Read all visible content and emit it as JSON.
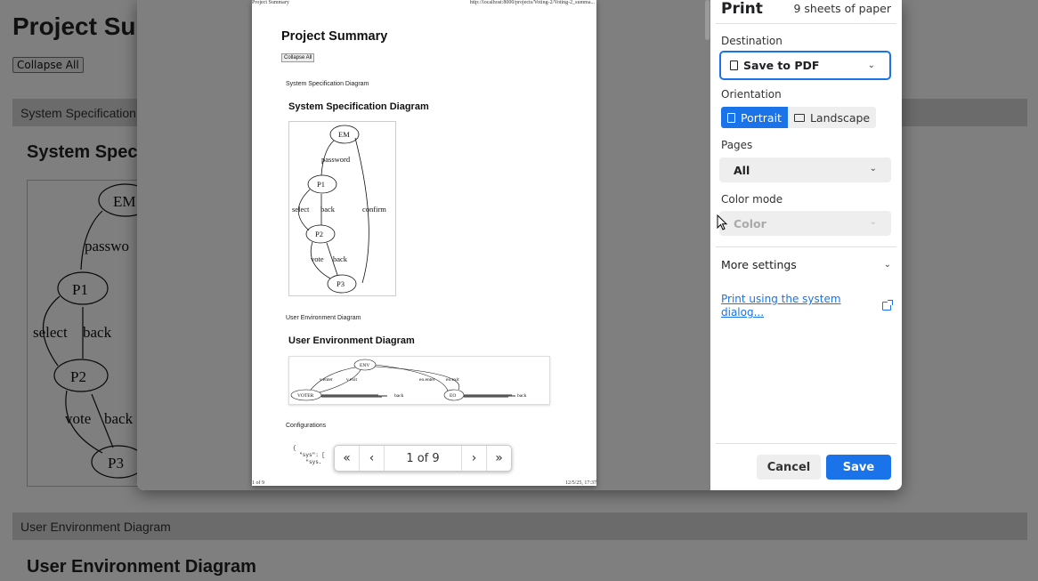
{
  "background": {
    "title": "Project Sur",
    "collapse_label": "Collapse All",
    "section1_bar": "System Specification",
    "section1_title": "System Spec",
    "diagram_labels": {
      "em": "EM",
      "password": "passwo",
      "p1": "P1",
      "select": "select",
      "back1": "back",
      "p2": "P2",
      "vote": "vote",
      "back2": "back",
      "p3": "P3"
    },
    "section2_bar": "User Environment Diagram",
    "section2_title": "User Environment Diagram"
  },
  "preview": {
    "header_left": "Project Summary",
    "header_right": "http://localhost:8000/projects/Voting-2/Voting-2_summa...",
    "title": "Project Summary",
    "collapse_label": "Collapse All",
    "section1_small": "System Specification Diagram",
    "section1_heading": "System Specification Diagram",
    "graph1": {
      "em": "EM",
      "password": "password",
      "p1": "P1",
      "select": "select",
      "back1": "back",
      "confirm": "confirm",
      "p2": "P2",
      "vote": "vote",
      "back2": "back",
      "p3": "P3"
    },
    "section2_small": "User Environment Diagram",
    "section2_heading": "User Environment Diagram",
    "graph2": {
      "env": "ENV",
      "enter": "v.enter",
      "exit": "v.exit",
      "eo_enter": "eo.enter",
      "eo_exit": "eo.exit",
      "voter": "VOTER",
      "eo": "EO",
      "back1": "back",
      "back2": "back"
    },
    "configurations": "Configurations",
    "code_line1": "{",
    "code_line2": "  \"sys\": [",
    "code_line3": "    \"sys.",
    "footer_left": "1 of 9",
    "footer_right": "12/5/25, 17:37",
    "pager": {
      "first": "«",
      "prev": "‹",
      "page": "1 of 9",
      "next": "›",
      "last": "»"
    }
  },
  "settings": {
    "title": "Print",
    "sheets": "9 sheets of paper",
    "destination_label": "Destination",
    "destination_value": "Save to PDF",
    "orientation_label": "Orientation",
    "portrait": "Portrait",
    "landscape": "Landscape",
    "pages_label": "Pages",
    "pages_value": "All",
    "color_label": "Color mode",
    "color_value": "Color",
    "more_settings": "More settings",
    "system_dialog_link": "Print using the system dialog...",
    "cancel": "Cancel",
    "save": "Save"
  },
  "colors": {
    "accent": "#1a73e8",
    "overlay": "rgba(0,0,0,0.5)",
    "section_bar": "#d7d7d7"
  }
}
